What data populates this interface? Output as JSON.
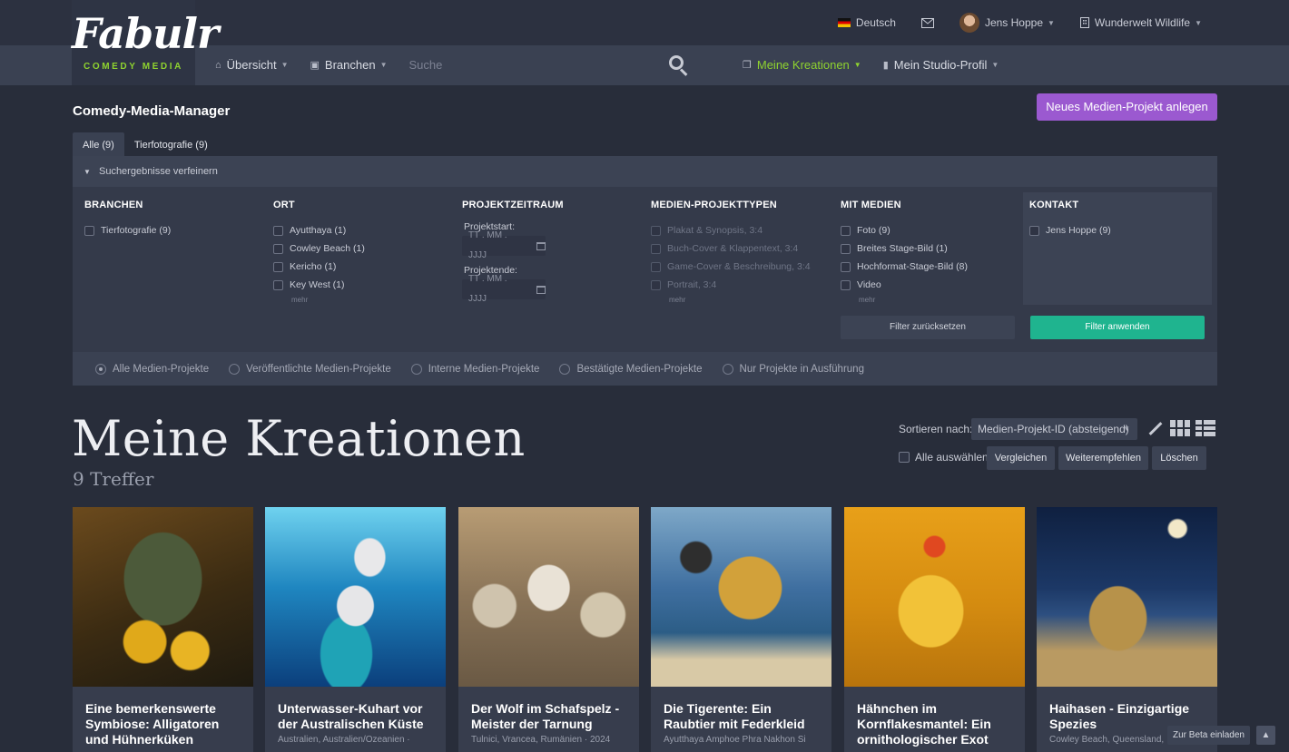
{
  "brand": {
    "name": "Fabulr",
    "tagline": "COMEDY MEDIA"
  },
  "topbar": {
    "language": "Deutsch",
    "user": "Jens Hoppe",
    "workspace": "Wunderwelt Wildlife"
  },
  "nav": {
    "overview": "Übersicht",
    "branches": "Branchen",
    "search_placeholder": "Suche",
    "my_creations": "Meine Kreationen",
    "studio_profile": "Mein Studio-Profil"
  },
  "page": {
    "heading": "Comedy-Media-Manager",
    "new_project_button": "Neues Medien-Projekt anlegen"
  },
  "tabs": [
    {
      "label": "Alle (9)",
      "active": true
    },
    {
      "label": "Tierfotografie (9)",
      "active": false
    }
  ],
  "filters": {
    "refine_label": "Suchergebnisse verfeinern",
    "branches": {
      "title": "BRANCHEN",
      "items": [
        "Tierfotografie (9)"
      ]
    },
    "location": {
      "title": "ORT",
      "items": [
        "Ayutthaya (1)",
        "Cowley Beach (1)",
        "Kericho (1)",
        "Key West (1)"
      ],
      "more": "mehr"
    },
    "period": {
      "title": "PROJEKTZEITRAUM",
      "start_label": "Projektstart:",
      "end_label": "Projektende:",
      "date_placeholder": "TT . MM . JJJJ"
    },
    "types": {
      "title": "MEDIEN-PROJEKTTYPEN",
      "items": [
        "Plakat & Synopsis, 3:4",
        "Buch-Cover & Klappentext, 3:4",
        "Game-Cover & Beschreibung, 3:4",
        "Portrait, 3:4"
      ],
      "more": "mehr"
    },
    "media": {
      "title": "MIT MEDIEN",
      "items": [
        "Foto (9)",
        "Breites Stage-Bild (1)",
        "Hochformat-Stage-Bild (8)",
        "Video"
      ],
      "more": "mehr"
    },
    "contact": {
      "title": "KONTAKT",
      "items": [
        "Jens Hoppe (9)"
      ]
    },
    "reset_button": "Filter zurücksetzen",
    "apply_button": "Filter anwenden"
  },
  "status_radios": [
    {
      "label": "Alle Medien-Projekte",
      "checked": true
    },
    {
      "label": "Veröffentlichte Medien-Projekte",
      "checked": false
    },
    {
      "label": "Interne Medien-Projekte",
      "checked": false
    },
    {
      "label": "Bestätigte Medien-Projekte",
      "checked": false
    },
    {
      "label": "Nur Projekte in Ausführung",
      "checked": false
    }
  ],
  "results": {
    "title": "Meine Kreationen",
    "count": "9 Treffer",
    "sort_label": "Sortieren nach:",
    "sort_value": "Medien-Projekt-ID (absteigend)",
    "select_all": "Alle auswählen",
    "compare_button": "Vergleichen",
    "recommend_button": "Weiterempfehlen",
    "delete_button": "Löschen"
  },
  "cards": [
    {
      "title": "Eine bemerkenswerte Symbiose: Alligatoren und Hühnerküken",
      "meta": ""
    },
    {
      "title": "Unterwasser-Kuhart vor der Australischen Küste",
      "meta": "Australien, Australien/Ozeanien ·"
    },
    {
      "title": "Der Wolf im Schafspelz - Meister der Tarnung",
      "meta": "Tulnici, Vrancea, Rumänien · 2024"
    },
    {
      "title": "Die Tigerente: Ein Raubtier mit Federkleid",
      "meta": "Ayutthaya Amphoe Phra Nakhon Si"
    },
    {
      "title": "Hähnchen im Kornflakesmantel: Ein ornithologischer Exot",
      "meta": ""
    },
    {
      "title": "Haihasen - Einzigartige Spezies",
      "meta": "Cowley Beach, Queensland,"
    }
  ],
  "footer": {
    "beta_button": "Zur Beta einladen"
  }
}
